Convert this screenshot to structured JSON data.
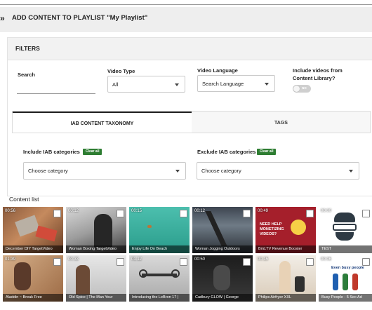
{
  "header": {
    "chevron": "»",
    "title": "ADD CONTENT TO PLAYLIST \"My Playlist\""
  },
  "filters": {
    "heading": "FILTERS",
    "search_label": "Search",
    "search_value": "",
    "video_type_label": "Video Type",
    "video_type_value": "All",
    "language_label": "Video Language",
    "language_value": "Search Language",
    "library_label_1": "Include videos from",
    "library_label_2": "Content Library?",
    "library_toggle_text": "NO"
  },
  "tabs": [
    {
      "label": "IAB CONTENT TAXONOMY",
      "active": true
    },
    {
      "label": "TAGS",
      "active": false
    }
  ],
  "iab": {
    "include_label": "Include IAB categories",
    "exclude_label": "Exclude IAB categories",
    "clear_label": "Clear all",
    "include_placeholder": "Choose category",
    "exclude_placeholder": "Choose category"
  },
  "content_list": {
    "label": "Content list",
    "videos": [
      {
        "duration": "00:56",
        "title": "December DIY TargetVideo"
      },
      {
        "duration": "00:12",
        "title": "Woman Boxing TargetVideo"
      },
      {
        "duration": "00:15",
        "title": "Enjoy Life On Beach"
      },
      {
        "duration": "00:12",
        "title": "Woman Jogging Outdoors"
      },
      {
        "duration": "00:49",
        "title": "Brid.TV Revenue Booster",
        "overlay_text": "NEED HELP MONETIZING VIDEOS?"
      },
      {
        "duration": "00:00",
        "title": "TEST"
      },
      {
        "duration": "01:39",
        "title": "Aladdin ~ Break Free"
      },
      {
        "duration": "00:33",
        "title": "Old Spice | The Man Your"
      },
      {
        "duration": "01:12",
        "title": "Introducing the LeBron 17 |"
      },
      {
        "duration": "00:50",
        "title": "Cadbury GLOW | George"
      },
      {
        "duration": "00:15",
        "title": "Philips Airfryer XXL"
      },
      {
        "duration": "00:06",
        "title": "Busy People - 5 Sec Ad",
        "overlay_text": "Even busy people"
      }
    ]
  },
  "colors": {
    "accent_green": "#2e7d32",
    "header_bg": "#eeeeee"
  }
}
